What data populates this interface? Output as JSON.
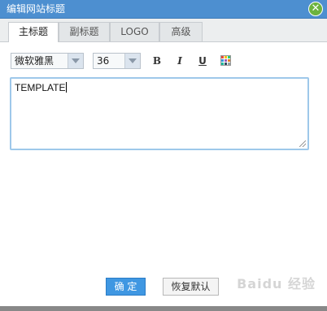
{
  "dialog": {
    "title": "编辑网站标题",
    "close_icon": "close-icon"
  },
  "tabs": [
    {
      "label": "主标题",
      "active": true
    },
    {
      "label": "副标题",
      "active": false
    },
    {
      "label": "LOGO",
      "active": false
    },
    {
      "label": "高级",
      "active": false
    }
  ],
  "toolbar": {
    "font_family": "微软雅黑",
    "font_size": "36",
    "bold_label": "B",
    "italic_label": "I",
    "underline_label": "U",
    "color_icon": "color-palette-icon"
  },
  "editor": {
    "value": "TEMPLATE"
  },
  "buttons": {
    "ok_label": "确 定",
    "reset_label": "恢复默认"
  },
  "watermark": {
    "text": "Baidu 经验"
  },
  "colors": {
    "titlebar": "#4d8fd0",
    "close": "#6cb33f",
    "ok_button": "#3f97e2",
    "editor_border": "#9ec8ea"
  }
}
